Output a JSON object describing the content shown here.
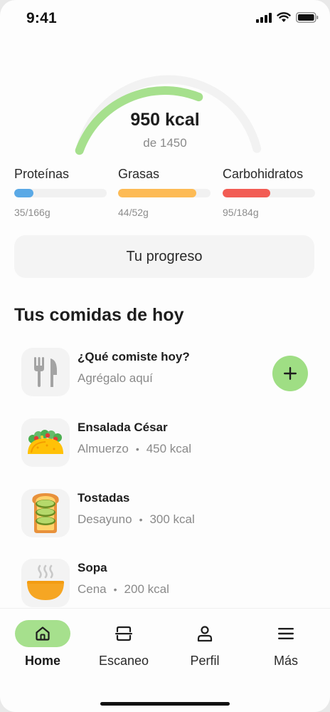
{
  "status_bar": {
    "time": "9:41"
  },
  "calories": {
    "value": "950 kcal",
    "goal": "de 1450",
    "progress": 0.655,
    "color": "#a6e08d",
    "track_color": "#f2f2f2"
  },
  "macros": [
    {
      "name": "Proteínas",
      "amount": "35/166g",
      "progress": 0.21,
      "color": "#5aa9e6"
    },
    {
      "name": "Grasas",
      "amount": "44/52g",
      "progress": 0.846,
      "color": "#fdbb55"
    },
    {
      "name": "Carbohidratos",
      "amount": "95/184g",
      "progress": 0.516,
      "color": "#f25c54"
    }
  ],
  "progress_button": {
    "label": "Tu progreso"
  },
  "section_title": "Tus comidas de hoy",
  "add_meal": {
    "title": "¿Qué comiste hoy?",
    "subtitle": "Agrégalo aquí",
    "icon": "fork-knife-icon"
  },
  "meals": [
    {
      "name": "Ensalada César",
      "meal_type": "Almuerzo",
      "calories": "450 kcal",
      "icon": "taco-icon"
    },
    {
      "name": "Tostadas",
      "meal_type": "Desayuno",
      "calories": "300 kcal",
      "icon": "toast-icon"
    },
    {
      "name": "Sopa",
      "meal_type": "Cena",
      "calories": "200 kcal",
      "icon": "soup-bowl-icon"
    }
  ],
  "tabs": [
    {
      "label": "Home",
      "icon": "home-icon",
      "active": true
    },
    {
      "label": "Escaneo",
      "icon": "scan-icon",
      "active": false
    },
    {
      "label": "Perfil",
      "icon": "person-icon",
      "active": false
    },
    {
      "label": "Más",
      "icon": "menu-icon",
      "active": false
    }
  ],
  "accent_color": "#a6e08d"
}
